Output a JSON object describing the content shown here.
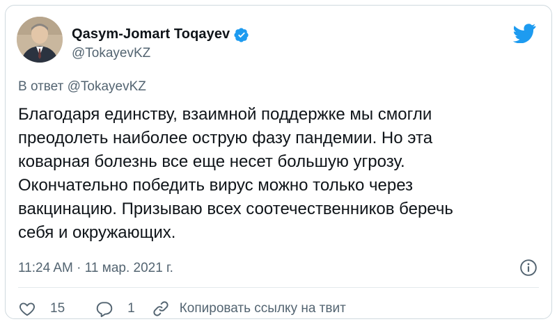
{
  "tweet": {
    "author": {
      "name": "Qasym-Jomart Toqayev",
      "handle": "@TokayevKZ",
      "verified": true
    },
    "reply_to": "В ответ @TokayevKZ",
    "text_lines": [
      "Благодаря единству, взаимной поддержке мы смогли",
      "преодолеть наиболее острую фазу пандемии. Но эта",
      "коварная болезнь все еще несет большую угрозу.",
      "Окончательно победить вирус можно только через",
      "вакцинацию. Призываю всех соотечественников беречь",
      "себя и окружающих."
    ],
    "timestamp": "11:24 AM · 11 мар. 2021 г.",
    "likes": "15",
    "replies": "1",
    "copy_link_label": "Копировать ссылку на твит"
  },
  "icons": {
    "brand": "twitter-bird-icon",
    "verified": "verified-badge-icon",
    "info": "info-icon",
    "like": "heart-icon",
    "reply": "reply-bubble-icon",
    "link": "link-icon"
  },
  "colors": {
    "brand_blue": "#1d9bf0",
    "text_primary": "#0f1419",
    "text_secondary": "#536471",
    "border": "#cfd9de"
  }
}
